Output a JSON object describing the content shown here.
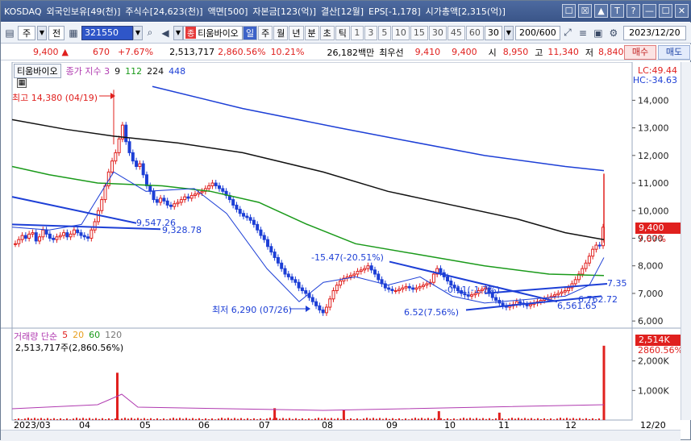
{
  "window": {
    "title_parts": [
      "KOSDAQ",
      "외국인보유[49(천)]",
      "주식수[24,623(천)]",
      "액면[500]",
      "자본금[123(억)]",
      "결산[12월]",
      "EPS[-1,178]",
      "시가총액[2,315(억)]"
    ],
    "buttons": [
      "☐",
      "☒",
      "▲",
      "T",
      "?",
      "—",
      "☐",
      "✕"
    ]
  },
  "toolbar": {
    "market_label": "주",
    "type_label": "전",
    "stock_code": "321550",
    "stock_name": "티움바이오",
    "stock_badge": "종",
    "periods": [
      "일",
      "주",
      "월",
      "년",
      "분",
      "초",
      "틱"
    ],
    "minute_options": [
      "1",
      "3",
      "5",
      "10",
      "15",
      "30",
      "45",
      "60"
    ],
    "minute_selected": "30",
    "count": "200/600",
    "date": "2023/12/20"
  },
  "quote": {
    "price": "9,400",
    "arrow": "▲",
    "change": "670",
    "change_rate": "+7.67%",
    "volume": "2,513,717",
    "volume_rate": "2,860.56%",
    "turnover": "10.21%",
    "amount": "26,182백만",
    "best_label": "최우선",
    "best_ask": "9,410",
    "best_bid": "9,400",
    "open_label": "시",
    "open": "8,950",
    "high_label": "고",
    "high": "11,340",
    "low_label": "저",
    "low": "8,840",
    "buy_label": "매수",
    "sell_label": "매도"
  },
  "chart": {
    "stock_name": "티움바이오",
    "ma_title": "종가 지수 3",
    "ma_periods": [
      "9",
      "112",
      "224",
      "448"
    ],
    "ma_colors": [
      "#111111",
      "#1a9a1a",
      "#111111",
      "#1d3fd6"
    ],
    "lc": "LC:49.44",
    "hc": "HC:-34.63",
    "annotations": {
      "high": "최고 14,380 (04/19)",
      "low": "최저 6,290 (07/26)",
      "a1": "9,547.26",
      "a2": "9,328.78",
      "a3": "-15.47(-20.51%)",
      "a4": "6.52(7.56%)",
      "a5": "-0.11(-1.7%)",
      "a6": "7.35",
      "a7": "6,762.72",
      "a8": "6,561.65"
    },
    "price_axis": [
      "14,000",
      "13,000",
      "12,000",
      "11,000",
      "10,000",
      "9,000",
      "8,000",
      "7,000",
      "6,000"
    ],
    "current_tag": "9,400",
    "current_rate": "7.67%",
    "volume_title": "거래량 단순",
    "volume_ma": [
      "5",
      "20",
      "60",
      "120"
    ],
    "volume_ma_colors": [
      "#e0201e",
      "#e8a020",
      "#1a9a1a",
      "#777777"
    ],
    "volume_current": "2,513,717주(2,860.56%)",
    "volume_axis": [
      "2,000K",
      "1,000K"
    ],
    "volume_tag": "2,514K",
    "volume_rate_tag": "2860.56%",
    "x_labels": [
      "2023/03",
      "04",
      "05",
      "06",
      "07",
      "08",
      "09",
      "10",
      "11",
      "12",
      "12/20"
    ]
  },
  "chart_data": {
    "type": "candlestick",
    "ylim": [
      5800,
      14800
    ],
    "candles": [
      [
        0,
        8800
      ],
      [
        4,
        8950
      ],
      [
        8,
        9100
      ],
      [
        12,
        9000
      ],
      [
        16,
        9150
      ],
      [
        20,
        9200
      ],
      [
        24,
        8900
      ],
      [
        28,
        9050
      ],
      [
        32,
        9300
      ],
      [
        36,
        9150
      ],
      [
        40,
        9000
      ],
      [
        44,
        8950
      ],
      [
        48,
        9050
      ],
      [
        52,
        9100
      ],
      [
        56,
        9200
      ],
      [
        60,
        9050
      ],
      [
        64,
        9150
      ],
      [
        68,
        9300
      ],
      [
        72,
        9200
      ],
      [
        76,
        9100
      ],
      [
        80,
        9050
      ],
      [
        84,
        9000
      ],
      [
        88,
        9300
      ],
      [
        92,
        9600
      ],
      [
        96,
        10000
      ],
      [
        100,
        10400
      ],
      [
        104,
        10900
      ],
      [
        108,
        11400
      ],
      [
        112,
        11800
      ],
      [
        116,
        12100
      ],
      [
        120,
        12600
      ],
      [
        124,
        13100
      ],
      [
        128,
        12500
      ],
      [
        132,
        12100
      ],
      [
        136,
        11800
      ],
      [
        140,
        11600
      ],
      [
        144,
        11700
      ],
      [
        148,
        11300
      ],
      [
        152,
        10900
      ],
      [
        156,
        10700
      ],
      [
        160,
        10400
      ],
      [
        164,
        10300
      ],
      [
        168,
        10450
      ],
      [
        172,
        10350
      ],
      [
        176,
        10200
      ],
      [
        180,
        10150
      ],
      [
        184,
        10250
      ],
      [
        188,
        10300
      ],
      [
        192,
        10400
      ],
      [
        196,
        10500
      ],
      [
        200,
        10450
      ],
      [
        204,
        10550
      ],
      [
        208,
        10600
      ],
      [
        212,
        10650
      ],
      [
        216,
        10700
      ],
      [
        220,
        10800
      ],
      [
        224,
        10900
      ],
      [
        228,
        11000
      ],
      [
        232,
        10900
      ],
      [
        236,
        10800
      ],
      [
        240,
        10700
      ],
      [
        244,
        10550
      ],
      [
        248,
        10400
      ],
      [
        252,
        10200
      ],
      [
        256,
        10050
      ],
      [
        260,
        9900
      ],
      [
        264,
        9800
      ],
      [
        268,
        9750
      ],
      [
        272,
        9650
      ],
      [
        276,
        9500
      ],
      [
        280,
        9300
      ],
      [
        284,
        9100
      ],
      [
        288,
        8950
      ],
      [
        292,
        8700
      ],
      [
        296,
        8500
      ],
      [
        300,
        8300
      ],
      [
        304,
        8100
      ],
      [
        308,
        7900
      ],
      [
        312,
        7700
      ],
      [
        316,
        7600
      ],
      [
        320,
        7500
      ],
      [
        324,
        7400
      ],
      [
        328,
        7200
      ],
      [
        332,
        7100
      ],
      [
        336,
        7000
      ],
      [
        340,
        6850
      ],
      [
        344,
        6700
      ],
      [
        348,
        6550
      ],
      [
        352,
        6400
      ],
      [
        356,
        6300
      ],
      [
        360,
        6500
      ],
      [
        364,
        6800
      ],
      [
        368,
        7100
      ],
      [
        372,
        7300
      ],
      [
        376,
        7450
      ],
      [
        380,
        7550
      ],
      [
        384,
        7600
      ],
      [
        388,
        7650
      ],
      [
        392,
        7700
      ],
      [
        396,
        7800
      ],
      [
        400,
        7850
      ],
      [
        404,
        7900
      ],
      [
        408,
        8000
      ],
      [
        412,
        7850
      ],
      [
        416,
        7700
      ],
      [
        420,
        7500
      ],
      [
        424,
        7350
      ],
      [
        428,
        7200
      ],
      [
        432,
        7150
      ],
      [
        436,
        7100
      ],
      [
        440,
        7100
      ],
      [
        444,
        7150
      ],
      [
        448,
        7200
      ],
      [
        452,
        7250
      ],
      [
        456,
        7200
      ],
      [
        460,
        7150
      ],
      [
        464,
        7200
      ],
      [
        468,
        7250
      ],
      [
        472,
        7300
      ],
      [
        476,
        7350
      ],
      [
        480,
        7400
      ],
      [
        484,
        7700
      ],
      [
        488,
        7900
      ],
      [
        492,
        7750
      ],
      [
        496,
        7600
      ],
      [
        500,
        7450
      ],
      [
        504,
        7300
      ],
      [
        508,
        7200
      ],
      [
        512,
        7100
      ],
      [
        516,
        7000
      ],
      [
        520,
        6950
      ],
      [
        524,
        6900
      ],
      [
        528,
        6950
      ],
      [
        532,
        7000
      ],
      [
        536,
        7100
      ],
      [
        540,
        7150
      ],
      [
        544,
        7200
      ],
      [
        548,
        7000
      ],
      [
        552,
        6850
      ],
      [
        556,
        6750
      ],
      [
        560,
        6650
      ],
      [
        564,
        6550
      ],
      [
        568,
        6500
      ],
      [
        572,
        6550
      ],
      [
        576,
        6600
      ],
      [
        580,
        6700
      ],
      [
        584,
        6650
      ],
      [
        588,
        6600
      ],
      [
        592,
        6550
      ],
      [
        596,
        6600
      ],
      [
        600,
        6650
      ],
      [
        604,
        6700
      ],
      [
        608,
        6750
      ],
      [
        612,
        6800
      ],
      [
        616,
        6850
      ],
      [
        620,
        6900
      ],
      [
        624,
        6950
      ],
      [
        628,
        7000
      ],
      [
        632,
        7050
      ],
      [
        636,
        7100
      ],
      [
        640,
        7200
      ],
      [
        644,
        7350
      ],
      [
        648,
        7500
      ],
      [
        652,
        7700
      ],
      [
        656,
        7900
      ],
      [
        660,
        8100
      ],
      [
        664,
        8350
      ],
      [
        668,
        8600
      ],
      [
        672,
        8750
      ],
      [
        676,
        8730
      ],
      [
        680,
        9400
      ]
    ],
    "volume_spikes": [
      [
        118,
        1600
      ],
      [
        300,
        400
      ],
      [
        380,
        350
      ],
      [
        490,
        300
      ],
      [
        560,
        250
      ],
      [
        740,
        2514
      ]
    ]
  }
}
